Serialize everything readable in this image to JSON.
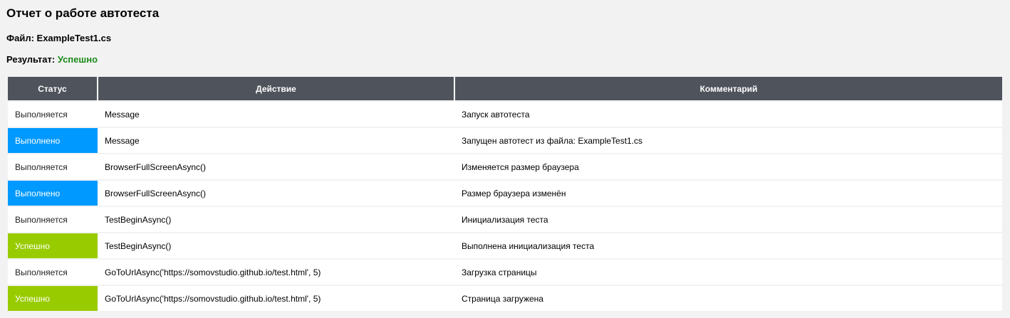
{
  "report": {
    "title": "Отчет о работе автотеста",
    "file_label": "Файл:",
    "file_value": "ExampleTest1.cs",
    "result_label": "Результат:",
    "result_value": "Успешно",
    "result_color": "#1a8a1a"
  },
  "table": {
    "headers": {
      "status": "Статус",
      "action": "Действие",
      "comment": "Комментарий"
    },
    "status_colors": {
      "Выполняется": "#ffffff",
      "Выполнено": "#0099ff",
      "Успешно": "#99cc00"
    },
    "rows": [
      {
        "status": "Выполняется",
        "action": "Message",
        "comment": "Запуск автотеста"
      },
      {
        "status": "Выполнено",
        "action": "Message",
        "comment": "Запущен автотест из файла: ExampleTest1.cs"
      },
      {
        "status": "Выполняется",
        "action": "BrowserFullScreenAsync()",
        "comment": "Изменяется размер браузера"
      },
      {
        "status": "Выполнено",
        "action": "BrowserFullScreenAsync()",
        "comment": "Размер браузера изменён"
      },
      {
        "status": "Выполняется",
        "action": "TestBeginAsync()",
        "comment": "Инициализация теста"
      },
      {
        "status": "Успешно",
        "action": "TestBeginAsync()",
        "comment": "Выполнена инициализация теста"
      },
      {
        "status": "Выполняется",
        "action": "GoToUrlAsync('https://somovstudio.github.io/test.html', 5)",
        "comment": "Загрузка страницы"
      },
      {
        "status": "Успешно",
        "action": "GoToUrlAsync('https://somovstudio.github.io/test.html', 5)",
        "comment": "Страница загружена"
      }
    ]
  }
}
